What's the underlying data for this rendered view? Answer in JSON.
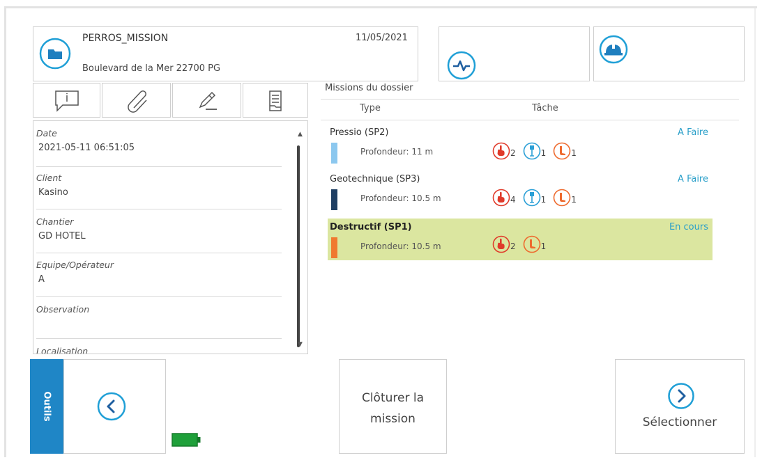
{
  "folder": {
    "name": "PERROS_MISSION",
    "date": "11/05/2021",
    "address": "Boulevard de la Mer 22700 PG"
  },
  "header_buttons": [
    {
      "icon": "activity-icon"
    },
    {
      "icon": "helmet-icon"
    }
  ],
  "tools": [
    {
      "icon": "info-comment-icon"
    },
    {
      "icon": "paperclip-icon"
    },
    {
      "icon": "pencil-icon"
    },
    {
      "icon": "document-icon"
    }
  ],
  "details": {
    "date_label": "Date",
    "date_value": "2021-05-11 06:51:05",
    "client_label": "Client",
    "client_value": "Kasino",
    "chantier_label": "Chantier",
    "chantier_value": "GD HOTEL",
    "equipe_label": "Equipe/Opérateur",
    "equipe_value": "A",
    "observation_label": "Observation",
    "observation_value": "",
    "localisation_label": "Localisation"
  },
  "missions": {
    "title": "Missions du dossier",
    "col_type": "Type",
    "col_task": "Tâche",
    "items": [
      {
        "name": "Pressio (SP2)",
        "depth": "Profondeur: 11 m",
        "status": "A Faire",
        "color": "#8cc8ef",
        "counts": {
          "hand": "2",
          "probe": "1",
          "boot": "1"
        }
      },
      {
        "name": "Geotechnique (SP3)",
        "depth": "Profondeur: 10.5 m",
        "status": "A Faire",
        "color": "#1f3f63",
        "counts": {
          "hand": "4",
          "probe": "1",
          "boot": "1"
        }
      },
      {
        "name": "Destructif (SP1)",
        "depth": "Profondeur: 10.5 m",
        "status": "En cours",
        "color": "#f07930",
        "counts": {
          "hand": "2",
          "boot": "1"
        }
      }
    ]
  },
  "bottom": {
    "outils_label": "Outils",
    "close_label_line1": "Clôturer la",
    "close_label_line2": "mission",
    "select_label": "Sélectionner"
  },
  "colors": {
    "accent": "#1f86c6",
    "status_text": "#2a9fc9",
    "selected_row": "#dbe6a0",
    "battery": "#1fa03a"
  }
}
